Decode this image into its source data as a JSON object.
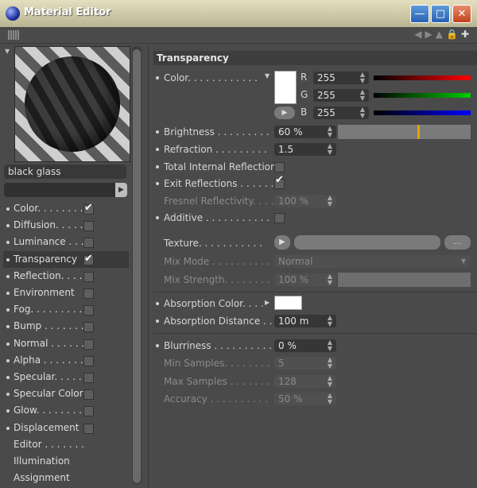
{
  "window": {
    "title": "Material Editor"
  },
  "material": {
    "name": "black glass"
  },
  "channels": [
    {
      "label": "Color. . . . . . . .",
      "checked": true
    },
    {
      "label": "Diffusion. . . . . .",
      "checked": false
    },
    {
      "label": "Luminance . . . .",
      "checked": false
    },
    {
      "label": "Transparency",
      "checked": true
    },
    {
      "label": "Reflection. . . . .",
      "checked": false
    },
    {
      "label": "Environment",
      "checked": false
    },
    {
      "label": "Fog. . . . . . . . .",
      "checked": false
    },
    {
      "label": "Bump . . . . . . . .",
      "checked": false
    },
    {
      "label": "Normal . . . . . .",
      "checked": false
    },
    {
      "label": "Alpha . . . . . . .",
      "checked": false
    },
    {
      "label": "Specular. . . . .",
      "checked": false
    },
    {
      "label": "Specular Color",
      "checked": false
    },
    {
      "label": "Glow. . . . . . . .",
      "checked": false
    },
    {
      "label": "Displacement",
      "checked": false
    },
    {
      "label": "Editor . . . . . . ."
    },
    {
      "label": "Illumination"
    },
    {
      "label": "Assignment"
    }
  ],
  "section": {
    "title": "Transparency"
  },
  "color": {
    "label": "Color. . . . . . . . . . . .",
    "r": "255",
    "g": "255",
    "b": "255",
    "r_label": "R",
    "g_label": "G",
    "b_label": "B"
  },
  "brightness": {
    "label": "Brightness . . . . . . . . .",
    "value": "60 %",
    "level": 0.6
  },
  "refraction": {
    "label": "Refraction . . . . . . . . .",
    "value": "1.5"
  },
  "total_internal": {
    "label": "Total Internal Reflection",
    "checked": false
  },
  "exit_reflections": {
    "label": "Exit Reflections . . . . . .",
    "checked": true
  },
  "fresnel": {
    "label": "Fresnel Reflectivity. . . .",
    "value": "100 %"
  },
  "additive": {
    "label": "Additive . . . . . . . . . . .",
    "checked": false
  },
  "texture": {
    "label": "Texture. . . . . . . . . . .",
    "more_label": "..."
  },
  "mix_mode": {
    "label": "Mix Mode . . . . . . . . . .",
    "value": "Normal"
  },
  "mix_strength": {
    "label": "Mix Strength. . . . . . . .",
    "value": "100 %"
  },
  "absorption_color": {
    "label": "Absorption Color. . . ."
  },
  "absorption_distance": {
    "label": "Absorption Distance . . . .",
    "value": "100 m"
  },
  "blurriness": {
    "label": "Blurriness . . . . . . . . . .",
    "value": "0 %"
  },
  "min_samples": {
    "label": "Min Samples. . . . . . . .",
    "value": "5"
  },
  "max_samples": {
    "label": "Max Samples . . . . . . .",
    "value": "128"
  },
  "accuracy": {
    "label": "Accuracy . . . . . . . . . .",
    "value": "50 %"
  },
  "colors": {
    "red": "#ff0000",
    "green": "#00cc00",
    "blue": "#0000ff",
    "accent": "#e8a000"
  }
}
